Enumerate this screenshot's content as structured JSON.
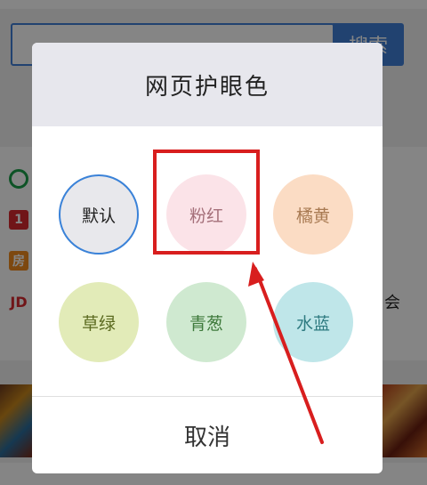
{
  "background": {
    "search_button": "搜索",
    "right_text": "会",
    "icons": [
      "qq-browser-icon",
      "news-icon",
      "house-icon",
      "jd-icon"
    ],
    "icon_labels": [
      "1",
      "房",
      "JD"
    ]
  },
  "dialog": {
    "title": "网页护眼色",
    "options": [
      {
        "label": "默认",
        "color": "#e8e8ec",
        "text_color": "#222222",
        "selected": true
      },
      {
        "label": "粉红",
        "color": "#fbe3e8",
        "text_color": "#a5707a"
      },
      {
        "label": "橘黄",
        "color": "#fbdcc4",
        "text_color": "#a87a52"
      },
      {
        "label": "草绿",
        "color": "#e2ebb8",
        "text_color": "#5b6a20"
      },
      {
        "label": "青葱",
        "color": "#cfe9d0",
        "text_color": "#3f7a3c"
      },
      {
        "label": "水蓝",
        "color": "#bfe6e9",
        "text_color": "#2e7a80"
      }
    ],
    "cancel_label": "取消"
  },
  "colors": {
    "accent_blue": "#3f7fd8",
    "annotation_red": "#d81e1e",
    "selected_ring": "#3a82d8"
  }
}
